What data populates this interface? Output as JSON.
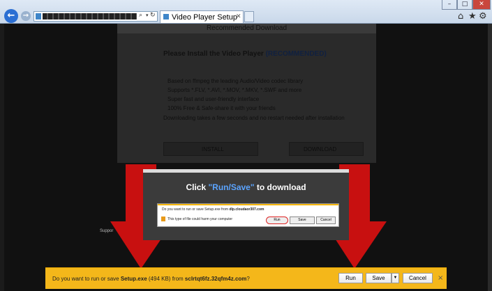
{
  "browser": {
    "tab_title": "Video Player Setup",
    "window_controls": {
      "minimize": "–",
      "maximize": "□",
      "close": "✕"
    },
    "toolbar": {
      "home": "⌂",
      "favorites": "★",
      "tools": "⚙"
    },
    "nav": {
      "back": "←",
      "forward": "→"
    }
  },
  "page": {
    "header": "Recommended Download",
    "title": "Please Install the Video Player",
    "title_tag": "(RECOMMENDED)",
    "features": [
      "Based on ffmpeg the leading Audio/Video codec library",
      "Supports *.FLV, *.AVI, *.MOV, *.MKV, *.SWF and more",
      "Super fast and user-friendly interface",
      "100% Free & Safe-share it with your friends",
      "Downloading takes a few seconds and no restart needed after installation"
    ],
    "install_label": "INSTALL",
    "download_label": "DOWNLOAD",
    "support_label": "Suppor"
  },
  "overlay": {
    "title_prefix": "Click",
    "title_highlight": "\"Run/Save\"",
    "title_suffix": "to download",
    "mini_prompt_prefix": "Do you want to run or save Setup.exe from",
    "mini_prompt_domain": "dlp.cloudaor307.com",
    "mini_warning": "This type of file could harm your computer",
    "mini_run": "Run",
    "mini_save": "Save",
    "mini_cancel": "Cancel"
  },
  "notification": {
    "prefix": "Do you want to run or save",
    "filename": "Setup.exe",
    "size": "(494 KB)",
    "from": "from",
    "domain": "sclrtqt6fz.32qfm4z.com",
    "suffix": "?",
    "run_label": "Run",
    "save_label": "Save",
    "cancel_label": "Cancel",
    "close_glyph": "×"
  },
  "colors": {
    "accent": "#5ba4ff",
    "notification_bg": "#f4b71a",
    "arrow_red": "#c81010"
  }
}
